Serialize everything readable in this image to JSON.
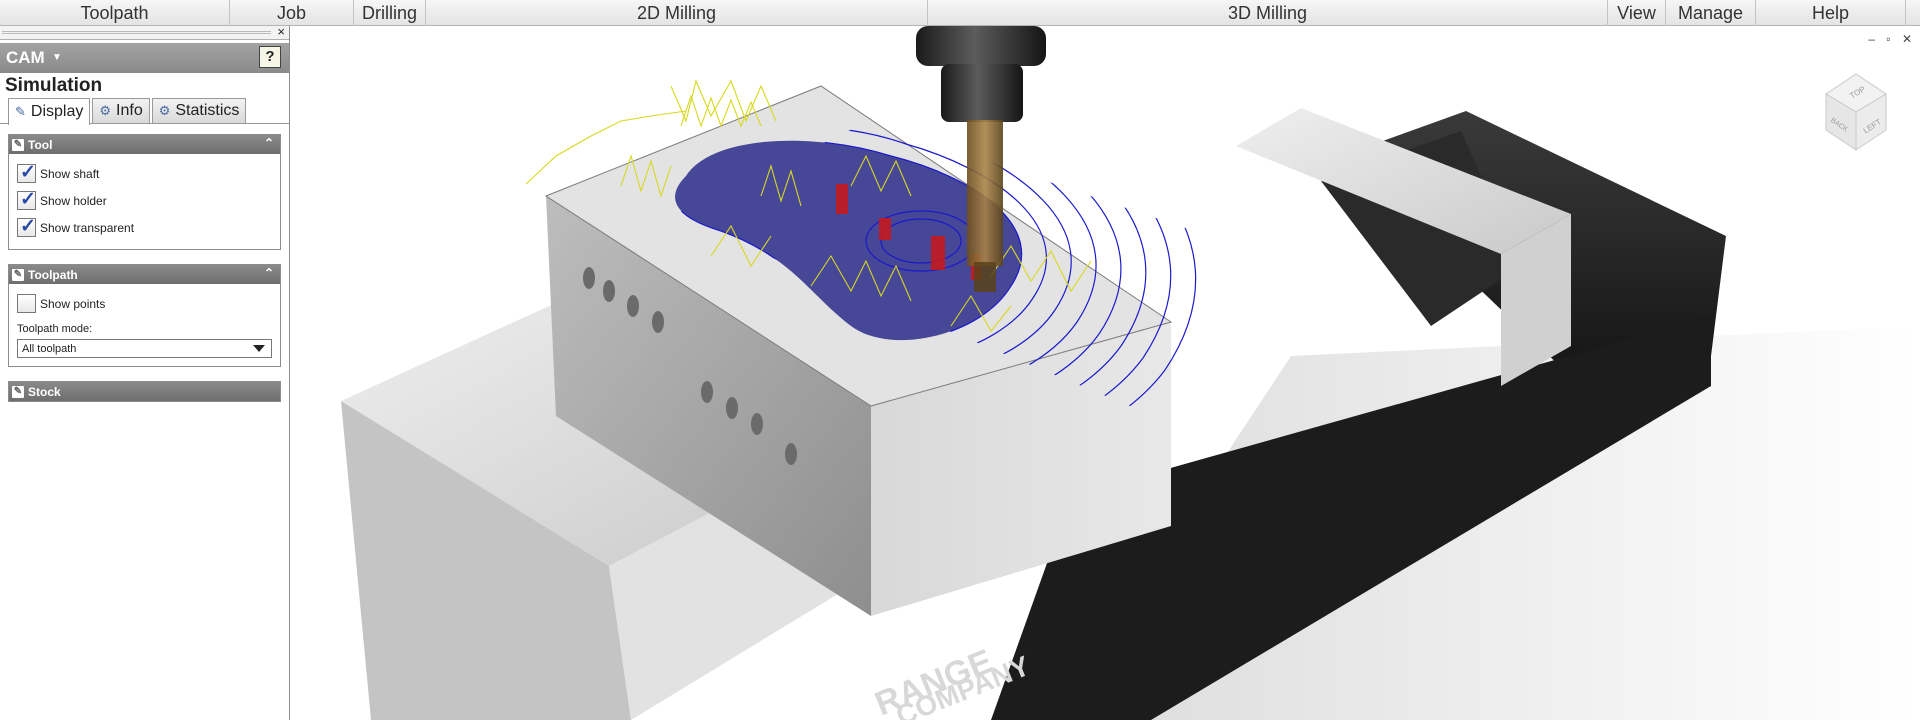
{
  "ribbon": {
    "tabs": [
      {
        "label": "Toolpath",
        "w": 230
      },
      {
        "label": "Job",
        "w": 124
      },
      {
        "label": "Drilling",
        "w": 72
      },
      {
        "label": "2D Milling",
        "w": 502
      },
      {
        "label": "3D Milling",
        "w": 680
      },
      {
        "label": "View",
        "w": 58
      },
      {
        "label": "Manage",
        "w": 90
      },
      {
        "label": "Help",
        "w": 150
      }
    ]
  },
  "panel": {
    "close_glyph": "×",
    "cam_label": "CAM",
    "help_glyph": "?",
    "title": "Simulation",
    "tabs": [
      {
        "label": "Display",
        "icon": "display-icon"
      },
      {
        "label": "Info",
        "icon": "info-icon"
      },
      {
        "label": "Statistics",
        "icon": "statistics-icon"
      }
    ],
    "tool_section": {
      "title": "Tool",
      "show_shaft": "Show shaft",
      "show_holder": "Show holder",
      "show_transparent": "Show transparent",
      "show_shaft_checked": true,
      "show_holder_checked": true,
      "show_transparent_checked": true
    },
    "toolpath_section": {
      "title": "Toolpath",
      "show_points": "Show points",
      "show_points_checked": false,
      "mode_label": "Toolpath mode:",
      "mode_value": "All toolpath"
    },
    "stock_section": {
      "title": "Stock"
    }
  },
  "viewport": {
    "window_controls": "– ▫ ✕",
    "viewcube": {
      "top": "TOP",
      "back": "BACK",
      "left": "LEFT"
    },
    "vise_text_1": "RANGE",
    "vise_text_2": "COMPANY",
    "colors": {
      "toolpath_blue": "#1a1acc",
      "toolpath_yellow": "#d8d820",
      "rapid_red": "#cc1818",
      "part": "#dcdcdc",
      "vise": "#202020"
    }
  }
}
